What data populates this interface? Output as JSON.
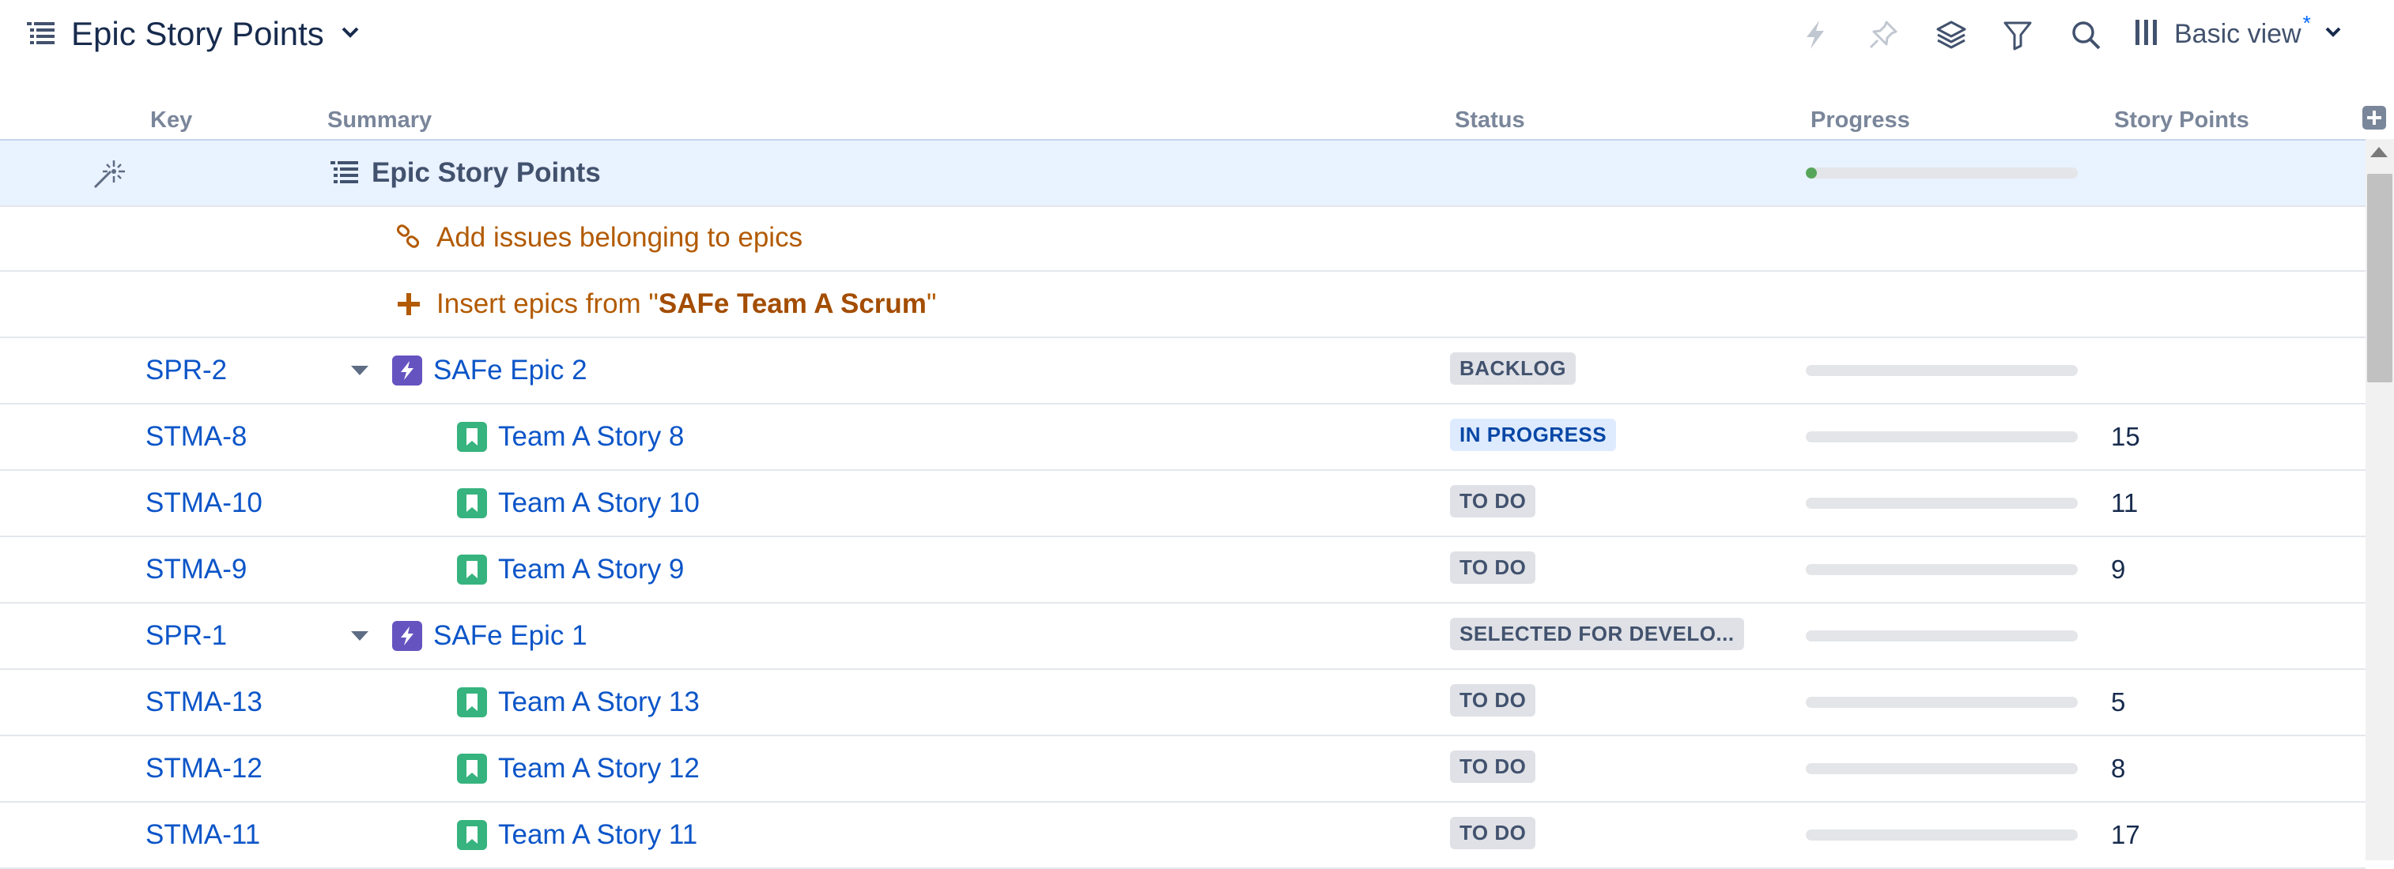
{
  "header": {
    "title": "Epic Story Points",
    "toolbar": [
      "automation-icon",
      "pin-icon",
      "layers-icon",
      "filter-icon",
      "search-icon"
    ],
    "view": {
      "label": "Basic view",
      "modified_marker": "*"
    }
  },
  "columns": {
    "key": "Key",
    "summary": "Summary",
    "status": "Status",
    "progress": "Progress",
    "story_points": "Story Points"
  },
  "root_row": {
    "title": "Epic Story Points",
    "progress": 0.02
  },
  "actions": {
    "add_issues": "Add issues belonging to epics",
    "insert_prefix": "Insert epics from \"",
    "insert_board": "SAFe Team A Scrum",
    "insert_suffix": "\""
  },
  "rows": [
    {
      "key": "SPR-2",
      "summary": "SAFe Epic 2",
      "type": "epic",
      "status": "BACKLOG",
      "status_color": "grey",
      "progress": 0,
      "story_points": ""
    },
    {
      "key": "STMA-8",
      "summary": "Team A Story 8",
      "type": "story",
      "status": "IN PROGRESS",
      "status_color": "blue",
      "progress": 0,
      "story_points": "15"
    },
    {
      "key": "STMA-10",
      "summary": "Team A Story 10",
      "type": "story",
      "status": "TO DO",
      "status_color": "grey",
      "progress": 0,
      "story_points": "11"
    },
    {
      "key": "STMA-9",
      "summary": "Team A Story 9",
      "type": "story",
      "status": "TO DO",
      "status_color": "grey",
      "progress": 0,
      "story_points": "9"
    },
    {
      "key": "SPR-1",
      "summary": "SAFe Epic 1",
      "type": "epic",
      "status": "SELECTED FOR DEVELO...",
      "status_color": "grey",
      "progress": 0,
      "story_points": ""
    },
    {
      "key": "STMA-13",
      "summary": "Team A Story 13",
      "type": "story",
      "status": "TO DO",
      "status_color": "grey",
      "progress": 0,
      "story_points": "5"
    },
    {
      "key": "STMA-12",
      "summary": "Team A Story 12",
      "type": "story",
      "status": "TO DO",
      "status_color": "grey",
      "progress": 0,
      "story_points": "8"
    },
    {
      "key": "STMA-11",
      "summary": "Team A Story 11",
      "type": "story",
      "status": "TO DO",
      "status_color": "grey",
      "progress": 0,
      "story_points": "17"
    }
  ],
  "colors": {
    "link": "#0c55c8",
    "action": "#b25a00",
    "epic": "#6554c0",
    "story": "#36b37e",
    "progress_fill": "#57a55a",
    "root_bg": "#e9f2ff"
  }
}
